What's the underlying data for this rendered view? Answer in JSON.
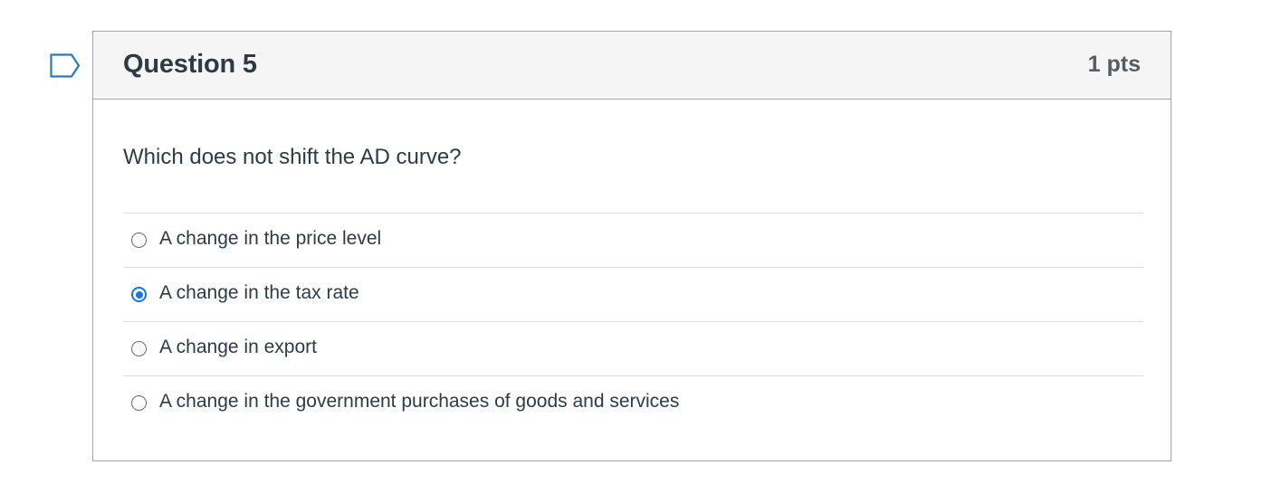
{
  "question": {
    "title": "Question 5",
    "points": "1 pts",
    "text": "Which does not shift the AD curve?",
    "answers": [
      {
        "label": "A change in the price level",
        "selected": false
      },
      {
        "label": "A change in the tax rate",
        "selected": true
      },
      {
        "label": "A change in export",
        "selected": false
      },
      {
        "label": "A change in the government purchases of goods and services",
        "selected": false
      }
    ]
  },
  "colors": {
    "accent": "#1a73e8",
    "flag": "#2b7abc",
    "header_bg": "#f5f5f5",
    "border": "#a5a5a5"
  },
  "icons": {
    "flag": "flag-question-icon"
  }
}
